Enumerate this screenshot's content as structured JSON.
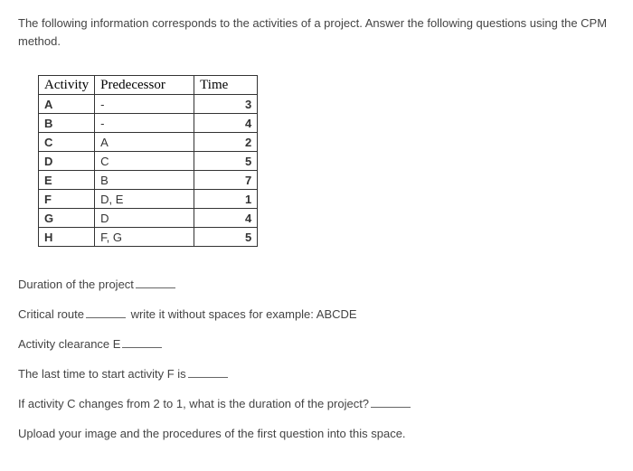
{
  "intro": "The following information corresponds to the activities of a project. Answer the following questions using the CPM method.",
  "table": {
    "headers": {
      "activity": "Activity",
      "predecessor": "Predecessor",
      "time": "Time"
    },
    "rows": [
      {
        "activity": "A",
        "predecessor": "-",
        "time": "3"
      },
      {
        "activity": "B",
        "predecessor": "-",
        "time": "4"
      },
      {
        "activity": "C",
        "predecessor": "A",
        "time": "2"
      },
      {
        "activity": "D",
        "predecessor": "C",
        "time": "5"
      },
      {
        "activity": "E",
        "predecessor": "B",
        "time": "7"
      },
      {
        "activity": "F",
        "predecessor": "D, E",
        "time": "1"
      },
      {
        "activity": "G",
        "predecessor": "D",
        "time": "4"
      },
      {
        "activity": "H",
        "predecessor": "F, G",
        "time": "5"
      }
    ]
  },
  "questions": {
    "q1": "Duration of the project",
    "q2_before": "Critical route",
    "q2_after": "write it without spaces for example: ABCDE",
    "q3": "Activity clearance E",
    "q4": "The last time to start activity F is",
    "q5": "If activity C changes from 2 to 1, what is the duration of the project?",
    "q6": "Upload your image and the procedures of the first question into this space."
  }
}
